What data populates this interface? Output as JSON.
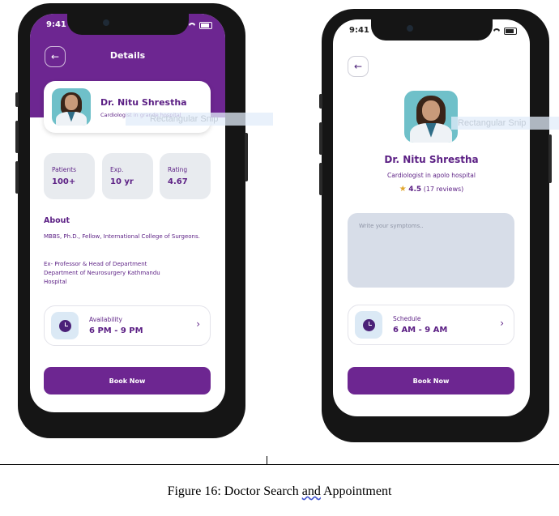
{
  "details_screen": {
    "status_time": "9:41",
    "header_title": "Details",
    "back_glyph": "←",
    "doctor_name": "Dr.  Nitu Shrestha",
    "specialty": "Cardiologist in grande hospital",
    "stats": [
      {
        "label": "Patients",
        "value": "100+"
      },
      {
        "label": "Exp.",
        "value": "10 yr"
      },
      {
        "label": "Rating",
        "value": "4.67"
      }
    ],
    "about_heading": "About",
    "about_paragraph_1": "MBBS, Ph.D., Fellow, International College of Surgeons.",
    "about_paragraph_2": "Ex- Professor & Head of Department Department of Neurosurgery Kathmandu Hospital",
    "availability_label": "Availability",
    "availability_value": "6 PM - 9 PM",
    "book_button": "Book Now"
  },
  "appointment_screen": {
    "status_time": "9:41",
    "back_glyph": "←",
    "doctor_name": "Dr. Nitu Shrestha",
    "specialty": "Cardiologist in apolo hospital",
    "rating_value": "4.5",
    "rating_reviews": "(17 reviews)",
    "symptoms_placeholder": "Write your symptoms..",
    "schedule_label": "Schedule",
    "schedule_value": "6 AM - 9 AM",
    "book_button": "Book Now"
  },
  "overlays": {
    "snip_label_1": "Rectangular Snip",
    "snip_label_2": "Rectangular Snip"
  },
  "caption": {
    "prefix": "Figure 16: Doctor Search ",
    "underlined": "and",
    "suffix": " Appointment"
  },
  "icons": [
    "back-arrow-icon",
    "clock-icon",
    "chevron-right-icon",
    "star-icon",
    "signal-icon",
    "wifi-icon",
    "battery-icon"
  ],
  "colors": {
    "brand_purple": "#6d2691",
    "text_purple": "#5b1f84",
    "stat_card_bg": "#e8ebef",
    "symptoms_bg": "#d7dde8",
    "star_gold": "#e1a52b"
  }
}
